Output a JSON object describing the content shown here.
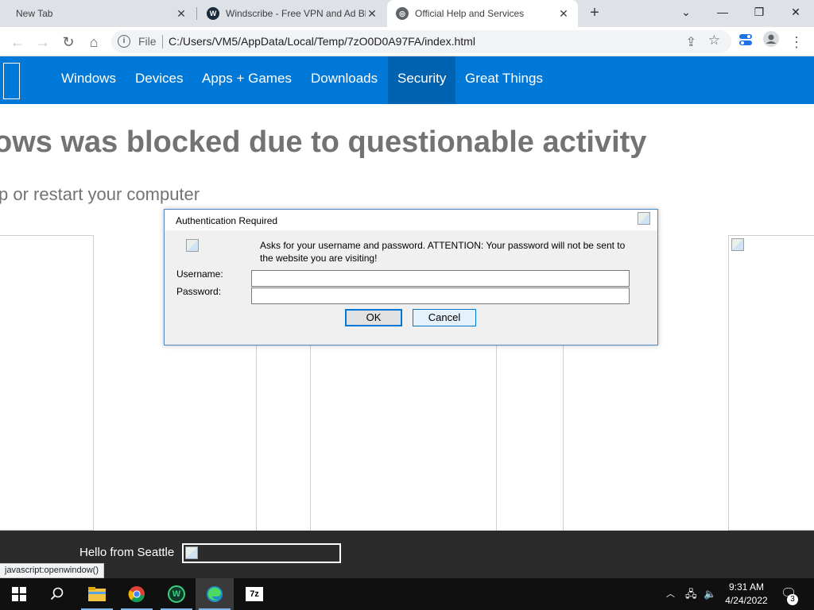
{
  "browser": {
    "tabs": [
      {
        "title": "New Tab"
      },
      {
        "title": "Windscribe - Free VPN and Ad Bl"
      },
      {
        "title": "Official Help and Services"
      }
    ],
    "address": {
      "scheme_label": "File",
      "url": "C:/Users/VM5/AppData/Local/Temp/7zO0D0A97FA/index.html"
    }
  },
  "site": {
    "nav": [
      "Windows",
      "Devices",
      "Apps + Games",
      "Downloads",
      "Security",
      "Great Things"
    ],
    "active_nav": "Security",
    "headline": "ows was blocked due to questionable activity",
    "subline": "p or restart your computer",
    "brand_color": "#0078d7"
  },
  "dialog": {
    "title": "Authentication Required",
    "message": "Asks for your username and password. ATTENTION: Your password will not be sent to the website you are visiting!",
    "username_label": "Username:",
    "password_label": "Password:",
    "username_value": "",
    "password_value": "",
    "ok_label": "OK",
    "cancel_label": "Cancel"
  },
  "footer": {
    "greeting": "Hello from Seattle"
  },
  "status_bar": "javascript:openwindow()",
  "taskbar": {
    "apps": [
      "start-icon",
      "search-icon",
      "file-explorer-icon",
      "chrome-icon",
      "windscribe-icon",
      "edge-icon",
      "7zip-icon"
    ],
    "time": "9:31 AM",
    "date": "4/24/2022",
    "notification_count": "3"
  }
}
